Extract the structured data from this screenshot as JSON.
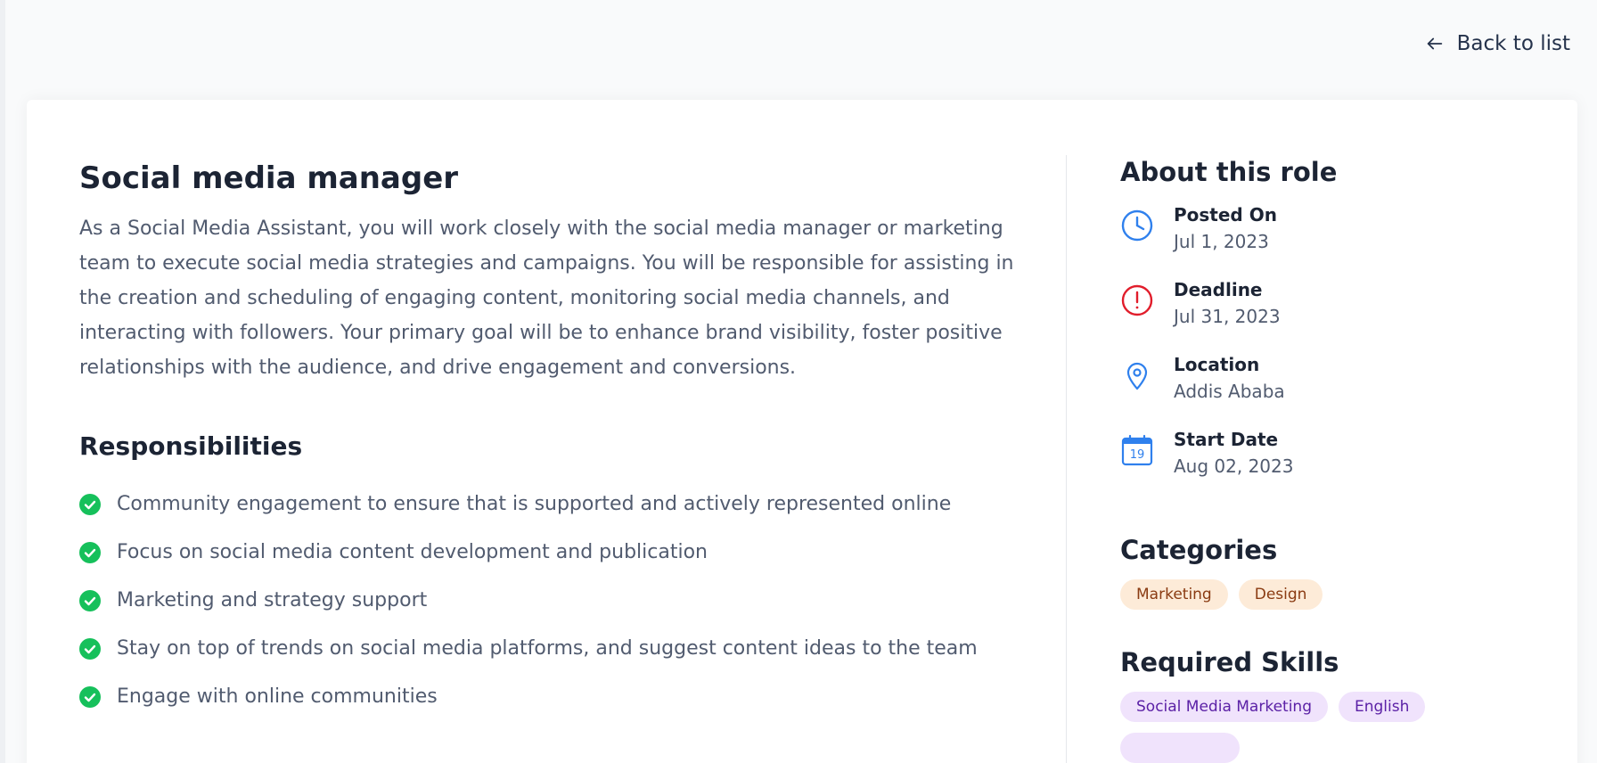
{
  "nav": {
    "back_label": "Back to list"
  },
  "job": {
    "title": "Social media manager",
    "description": "As a Social Media Assistant, you will work closely with the social media manager or marketing team to execute social media strategies and campaigns. You will be responsible for assisting in the creation and scheduling of engaging content, monitoring social media channels, and interacting with followers. Your primary goal will be to enhance brand visibility, foster positive relationships with the audience, and drive engagement and conversions.",
    "responsibilities_heading": "Responsibilities",
    "responsibilities": [
      "Community engagement to ensure that is supported and actively represented online",
      "Focus on social media content development and publication",
      "Marketing and strategy support",
      "Stay on top of trends on social media platforms, and suggest content ideas to the team",
      "Engage with online communities"
    ]
  },
  "about": {
    "heading": "About this role",
    "items": [
      {
        "label": "Posted On",
        "value": "Jul 1, 2023",
        "icon": "clock-icon"
      },
      {
        "label": "Deadline",
        "value": "Jul 31, 2023",
        "icon": "alert-circle-icon"
      },
      {
        "label": "Location",
        "value": "Addis Ababa",
        "icon": "map-pin-icon"
      },
      {
        "label": "Start Date",
        "value": "Aug 02, 2023",
        "icon": "calendar-icon",
        "icon_text": "19"
      }
    ]
  },
  "categories": {
    "heading": "Categories",
    "items": [
      "Marketing",
      "Design"
    ]
  },
  "skills": {
    "heading": "Required Skills",
    "items": [
      "Social Media Marketing",
      "English"
    ]
  },
  "colors": {
    "accent_blue": "#2f80ed",
    "deadline_red": "#e11d2b",
    "check_green": "#16c05b",
    "category_bg": "#fdebd8",
    "category_text": "#8a3b12",
    "skill_bg": "#f0e3fc",
    "skill_text": "#5b21a6"
  }
}
